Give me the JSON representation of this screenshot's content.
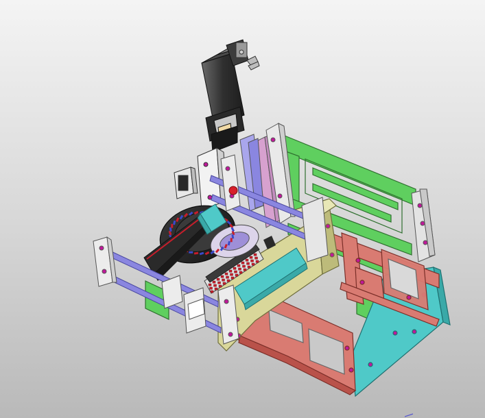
{
  "viewport": {
    "background_top": "#f4f4f4",
    "background_bottom": "#b9b9b9"
  },
  "model": {
    "description_visible_text": "",
    "colors": {
      "green_frame": "#5fcf5f",
      "red_frame": "#d97b72",
      "cyan_plate": "#4fc9c8",
      "yellow_plate": "#d9d79a",
      "blue_rods": "#8a86e0",
      "white_blocks": "#e6e6e6",
      "motor_body": "#3a3a3a",
      "pink_plate": "#d9a0d0",
      "dial_ring": "#2b2b2b",
      "mark_red": "#c81e2b",
      "mark_blue": "#3a49c8",
      "mounting_hole": "#c0189a"
    }
  }
}
